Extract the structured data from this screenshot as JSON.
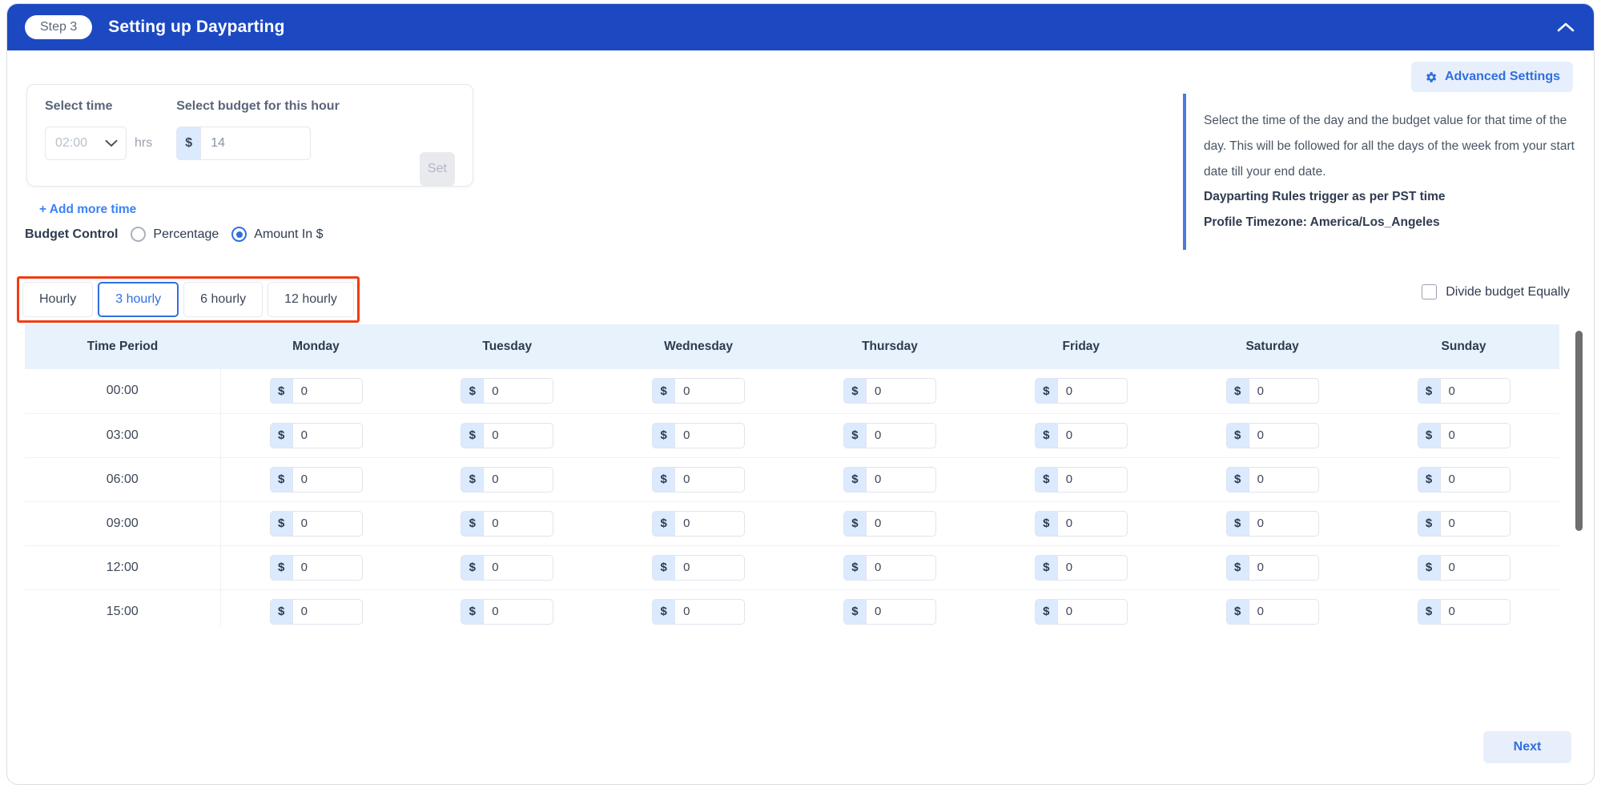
{
  "header": {
    "step_badge": "Step 3",
    "title": "Setting up Dayparting",
    "collapse_icon": "chevron-up-icon"
  },
  "advanced_settings": {
    "label": "Advanced Settings",
    "icon": "gear-icon",
    "accent_color": "#2f6fe0"
  },
  "form": {
    "time_label": "Select time",
    "time_value": "02:00",
    "time_unit": "hrs",
    "budget_label": "Select budget for this hour",
    "currency_symbol": "$",
    "budget_value": "14",
    "set_button": "Set",
    "add_more_link": "+ Add more time"
  },
  "budget_control": {
    "label": "Budget Control",
    "options": [
      {
        "label": "Percentage",
        "selected": false
      },
      {
        "label": "Amount In $",
        "selected": true
      }
    ]
  },
  "tabs": {
    "items": [
      {
        "label": "Hourly",
        "active": false
      },
      {
        "label": "3 hourly",
        "active": true
      },
      {
        "label": "6 hourly",
        "active": false
      },
      {
        "label": "12 hourly",
        "active": false
      }
    ],
    "annotation_color": "#f43a13"
  },
  "divide_equally": {
    "label": "Divide budget Equally",
    "checked": false
  },
  "info_panel": {
    "paragraph": "Select the time of the day and the budget value for that time of the day. This will be followed for all the days of the week from your start date till your end date.",
    "bold_line_1": "Dayparting Rules trigger as per PST time",
    "bold_line_2": "Profile Timezone: America/Los_Angeles",
    "accent_color": "#4a7ae0"
  },
  "table": {
    "columns": [
      "Time Period",
      "Monday",
      "Tuesday",
      "Wednesday",
      "Thursday",
      "Friday",
      "Saturday",
      "Sunday"
    ],
    "currency_symbol": "$",
    "rows": [
      {
        "time": "00:00",
        "values": [
          "0",
          "0",
          "0",
          "0",
          "0",
          "0",
          "0"
        ]
      },
      {
        "time": "03:00",
        "values": [
          "0",
          "0",
          "0",
          "0",
          "0",
          "0",
          "0"
        ]
      },
      {
        "time": "06:00",
        "values": [
          "0",
          "0",
          "0",
          "0",
          "0",
          "0",
          "0"
        ]
      },
      {
        "time": "09:00",
        "values": [
          "0",
          "0",
          "0",
          "0",
          "0",
          "0",
          "0"
        ]
      },
      {
        "time": "12:00",
        "values": [
          "0",
          "0",
          "0",
          "0",
          "0",
          "0",
          "0"
        ]
      },
      {
        "time": "15:00",
        "values": [
          "0",
          "0",
          "0",
          "0",
          "0",
          "0",
          "0"
        ]
      }
    ]
  },
  "footer": {
    "next_button": "Next"
  }
}
